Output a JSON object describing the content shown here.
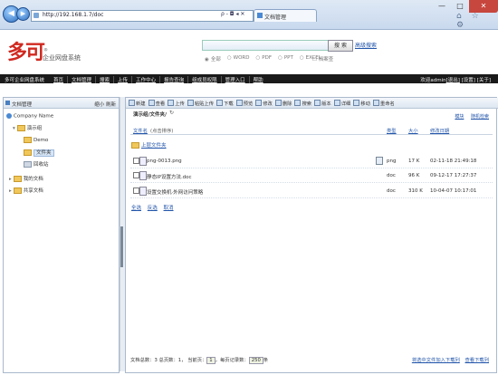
{
  "browser": {
    "url": "http://192.168.1.7/doc",
    "addr_tools": "ρ - ◘ ◂ ✕",
    "tab_title": "文档管理",
    "window_controls": [
      "—",
      "□",
      "✕"
    ],
    "right_icons": "⌂ ☆ ⚙"
  },
  "header": {
    "logo": "多可",
    "logo_mark": "®",
    "subtitle": "企业网盘系统",
    "search_button": "搜 索",
    "advanced_search": "高级搜索",
    "filters": [
      "全部",
      "WORD",
      "PDF",
      "PPT",
      "EXCEL"
    ],
    "selected_filter": "全部",
    "archive_query": "档案查"
  },
  "navbar": {
    "brand": "多可企业网盘系统",
    "links": [
      "首页",
      "文档管理",
      "搜索",
      "上传",
      "工作中心",
      "报告查询",
      "组成员权限",
      "管理入口",
      "帮助"
    ],
    "welcome": "欢迎admin",
    "exit": "[退出]",
    "settings": "[设置]",
    "about": "[关于]"
  },
  "left": {
    "title": "文档管理",
    "collapse": "缩小",
    "refresh": "刷新",
    "tree": {
      "company": "Company Name",
      "demo_group": "演示组",
      "demo": "Demo",
      "files": "文件夹",
      "recycle": "回收站",
      "my_docs": "我的文档",
      "shared_docs": "共享文档"
    }
  },
  "toolbar": [
    "新建",
    "查看",
    "上传",
    "粘贴上传",
    "下载",
    "预览",
    "修改",
    "删除",
    "搜索",
    "版本",
    "详细",
    "移动",
    "重命名"
  ],
  "path": {
    "label": "演示组/文件夹/",
    "refresh_icon": "↻",
    "link_one": "模块",
    "link_two": "随机检索"
  },
  "columns": {
    "name": "文件名",
    "sort_note": "(点击排序)",
    "type": "类型",
    "size": "大小",
    "modified": "修改日期"
  },
  "up_folder": "上层文件夹",
  "files": [
    {
      "name": "png-0013.png",
      "type": "png",
      "size": "17 K",
      "date": "02-11-18 21:49:18"
    },
    {
      "name": "静态IP设置方法.doc",
      "type": "doc",
      "size": "96 K",
      "date": "09-12-17 17:27:37"
    },
    {
      "name": "设置交换机·外网访问策略",
      "type": "doc",
      "size": "310 K",
      "date": "10-04-07 10:17:01"
    }
  ],
  "selectors": [
    "全选",
    "反选",
    "取消"
  ],
  "footer": {
    "doc_count_label": "文档总数：3",
    "total_pages_label": "总页数：1，",
    "current_page_label": "当前页：",
    "current_page": "1",
    "per_page_label": "，每页记录数：",
    "per_page": "250",
    "per_page_suffix": "条",
    "link_one": "将选中文件加入下载列",
    "link_two": "查看下载列"
  }
}
